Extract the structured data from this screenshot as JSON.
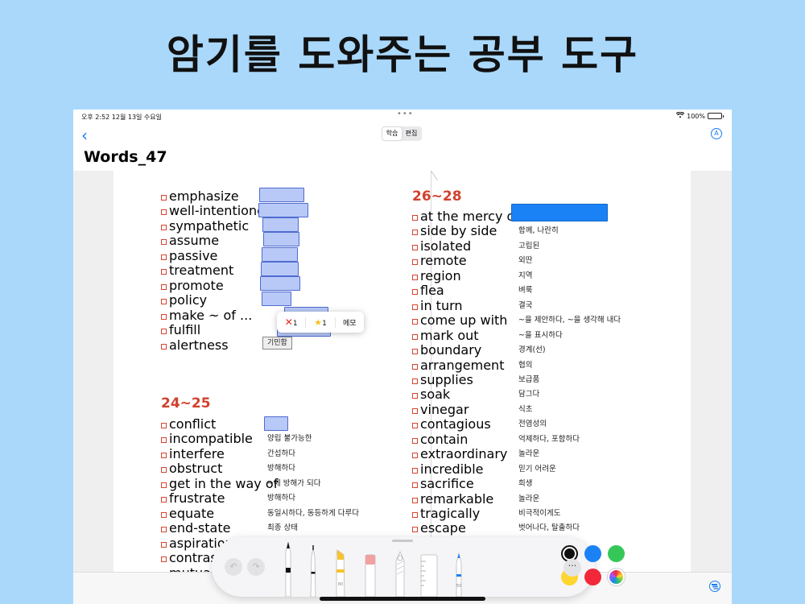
{
  "headline": "암기를 도와주는 공부 도구",
  "status": {
    "time": "오후 2:52   12월 13일 수요일",
    "battery": "100%"
  },
  "nav": {
    "back_icon": "chevron-left-icon",
    "seg_study": "학습",
    "seg_edit": "편집",
    "title": "Words_47"
  },
  "left_column": [
    {
      "word": "emphasize"
    },
    {
      "word": "well-intentioned"
    },
    {
      "word": "sympathetic"
    },
    {
      "word": "assume"
    },
    {
      "word": "passive"
    },
    {
      "word": "treatment"
    },
    {
      "word": "promote"
    },
    {
      "word": "policy"
    },
    {
      "word": "make ~ of ..."
    },
    {
      "word": "fulfill"
    },
    {
      "word": "alertness",
      "meaning": "기민함"
    }
  ],
  "section_24": {
    "heading": "24~25",
    "items": [
      {
        "word": "conflict",
        "meaning": ""
      },
      {
        "word": "incompatible",
        "meaning": "양립 불가능한"
      },
      {
        "word": "interfere",
        "meaning": "간섭하다"
      },
      {
        "word": "obstruct",
        "meaning": "방해하다"
      },
      {
        "word": "get in the way of",
        "meaning": "~에 방해가 되다"
      },
      {
        "word": "frustrate",
        "meaning": "방해하다"
      },
      {
        "word": "equate",
        "meaning": "동일시하다, 동등하게 다루다"
      },
      {
        "word": "end-state",
        "meaning": "최종 상태"
      },
      {
        "word": "aspiration",
        "meaning": ""
      },
      {
        "word": "contrasting",
        "meaning": ""
      },
      {
        "word": "mutual",
        "meaning": ""
      }
    ]
  },
  "section_26": {
    "heading": "26~28",
    "items": [
      {
        "word": "at the mercy of",
        "meaning": ""
      },
      {
        "word": "side by side",
        "meaning": "함께, 나란히"
      },
      {
        "word": "isolated",
        "meaning": "고립된"
      },
      {
        "word": "remote",
        "meaning": "외딴"
      },
      {
        "word": "region",
        "meaning": "지역"
      },
      {
        "word": "flea",
        "meaning": "벼룩"
      },
      {
        "word": "in turn",
        "meaning": "결국"
      },
      {
        "word": "come up with",
        "meaning": "~을 제안하다, ~을 생각해 내다"
      },
      {
        "word": "mark out",
        "meaning": "~을 표시하다"
      },
      {
        "word": "boundary",
        "meaning": "경계(선)"
      },
      {
        "word": "arrangement",
        "meaning": "협의"
      },
      {
        "word": "supplies",
        "meaning": "보급품"
      },
      {
        "word": "soak",
        "meaning": "담그다"
      },
      {
        "word": "vinegar",
        "meaning": "식초"
      },
      {
        "word": "contagious",
        "meaning": "전염성의"
      },
      {
        "word": "contain",
        "meaning": "억제하다, 포함하다"
      },
      {
        "word": "extraordinary",
        "meaning": "놀라운"
      },
      {
        "word": "incredible",
        "meaning": "믿기 어려운"
      },
      {
        "word": "sacrifice",
        "meaning": "희생"
      },
      {
        "word": "remarkable",
        "meaning": "놀라운"
      },
      {
        "word": "tragically",
        "meaning": "비극적이게도"
      },
      {
        "word": "escape",
        "meaning": "벗어나다, 탈출하다"
      }
    ]
  },
  "popup": {
    "wrong_count": "1",
    "star_count": "1",
    "memo": "메모"
  },
  "toolbar": {
    "colors": [
      "#111111",
      "#1a82f5",
      "#36c759",
      "#ffd52e",
      "#f2283a",
      "rainbow"
    ],
    "tools": [
      "pen-icon",
      "fineliner-icon",
      "marker-icon",
      "eraser-icon",
      "lasso-icon",
      "ruler-icon",
      "pencil-icon"
    ],
    "marker_size": "80",
    "pencil_size": "50"
  }
}
